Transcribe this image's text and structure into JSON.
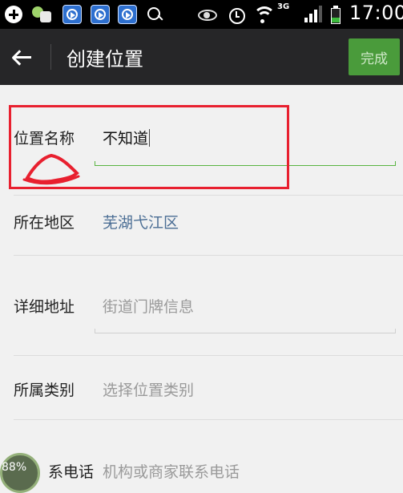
{
  "status_bar": {
    "network": "3G",
    "time": "17:00",
    "battery_level": 0.4,
    "signal_bars": 3
  },
  "action_bar": {
    "title": "创建位置",
    "done_label": "完成"
  },
  "form": {
    "name": {
      "label": "位置名称",
      "value": "不知道"
    },
    "region": {
      "label": "所在地区",
      "value": "芜湖弋江区"
    },
    "address": {
      "label": "详细地址",
      "placeholder": "街道门牌信息"
    },
    "category": {
      "label": "所属类别",
      "placeholder": "选择位置类别"
    },
    "phone": {
      "label": "系电话",
      "placeholder": "机构或商家联系电话"
    }
  },
  "overlay": {
    "percent": "88%"
  },
  "colors": {
    "accent": "#59b440",
    "done_button": "#4a9b3b",
    "highlight": "#e8202f",
    "link": "#4a6d94"
  }
}
